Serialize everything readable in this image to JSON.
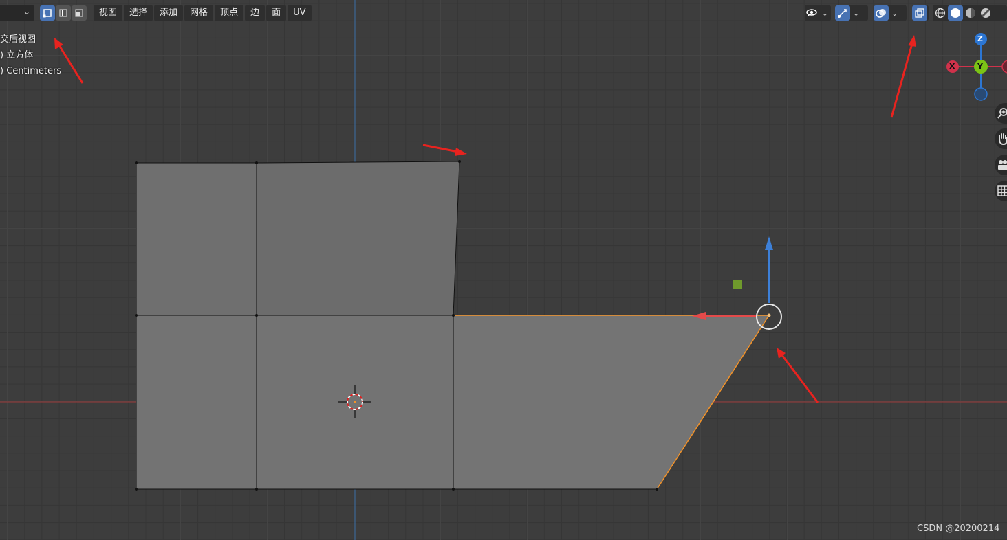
{
  "header": {
    "mode_dropdown_icon": "chevron-down-icon",
    "select_modes": [
      "vertex-select-icon",
      "edge-select-icon",
      "face-select-icon"
    ],
    "menus": [
      "视图",
      "选择",
      "添加",
      "网格",
      "顶点",
      "边",
      "面",
      "UV"
    ]
  },
  "overlay": {
    "view_name": "交后视图",
    "object_name": ") 立方体",
    "scale": ") Centimeters"
  },
  "gizmo": {
    "z_label": "Z",
    "y_label": "Y",
    "x_label": "X",
    "colors": {
      "x": "#d0324b",
      "y": "#7bc416",
      "z": "#2c76d3"
    }
  },
  "nav_icons": [
    "zoom-icon",
    "pan-hand-icon",
    "camera-icon",
    "grid-icon"
  ],
  "right_header_icons": [
    "visibility-eye-icon",
    "gizmo-toggle-icon",
    "overlay-toggle-icon",
    "xray-toggle-icon",
    "wireframe-shading-icon",
    "solid-shading-icon",
    "material-shading-icon",
    "rendered-shading-icon"
  ],
  "watermark": "CSDN @20200214",
  "colors": {
    "accent": "#4772b3",
    "annotation_arrow": "#e8231f",
    "selection": "#f3932a"
  }
}
